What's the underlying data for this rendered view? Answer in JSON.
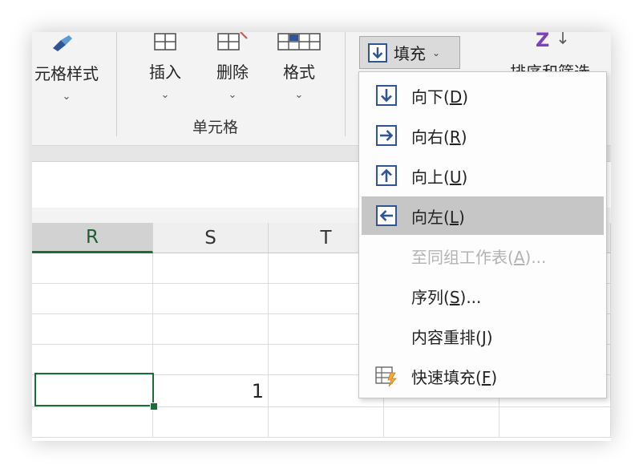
{
  "ribbon": {
    "cell_styles_label": "元格样式",
    "insert_label": "插入",
    "delete_label": "删除",
    "format_label": "格式",
    "group_label": "单元格",
    "fill_button_label": "填充",
    "sort_filter_label": "排序和筛选",
    "chevron": "⌄"
  },
  "columns": [
    "R",
    "S",
    "T"
  ],
  "cells": {
    "s_row5_value": "1"
  },
  "fill_menu": {
    "items": [
      {
        "label": "向下",
        "key": "D",
        "icon": "fill-down-icon",
        "state": "normal"
      },
      {
        "label": "向右",
        "key": "R",
        "icon": "fill-right-icon",
        "state": "normal"
      },
      {
        "label": "向上",
        "key": "U",
        "icon": "fill-up-icon",
        "state": "normal"
      },
      {
        "label": "向左",
        "key": "L",
        "icon": "fill-left-icon",
        "state": "hover"
      },
      {
        "label": "至同组工作表",
        "key": "A",
        "suffix": "...",
        "icon": "",
        "state": "disabled"
      },
      {
        "label": "序列",
        "key": "S",
        "suffix": "...",
        "icon": "",
        "state": "normal"
      },
      {
        "label": "内容重排",
        "key": "J",
        "icon": "",
        "state": "normal"
      },
      {
        "label": "快速填充",
        "key": "F",
        "icon": "flash-fill-icon",
        "state": "normal"
      }
    ]
  },
  "colors": {
    "accent_green": "#1e6b3a",
    "icon_blue": "#2f5597",
    "hover_gray": "#c6c6c6"
  }
}
